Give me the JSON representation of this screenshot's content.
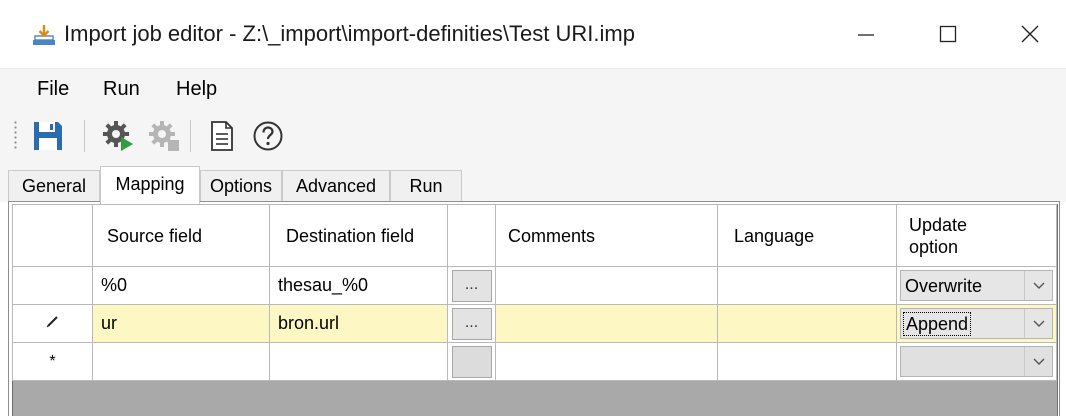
{
  "window": {
    "title": "Import job editor - Z:\\_import\\import-definities\\Test URI.imp",
    "minimize_label": "—",
    "maximize_label": "☐",
    "close_label": "✕"
  },
  "menu": {
    "items": [
      {
        "label": "File"
      },
      {
        "label": "Run"
      },
      {
        "label": "Help"
      }
    ]
  },
  "toolbar": {
    "buttons": [
      {
        "icon": "save-icon"
      },
      {
        "icon": "run-gear-icon"
      },
      {
        "icon": "run-gear-disabled-icon"
      },
      {
        "icon": "document-icon"
      },
      {
        "icon": "help-icon"
      }
    ]
  },
  "tabs": [
    {
      "label": "General",
      "selected": false
    },
    {
      "label": "Mapping",
      "selected": true
    },
    {
      "label": "Options",
      "selected": false
    },
    {
      "label": "Advanced",
      "selected": false
    },
    {
      "label": "Run",
      "selected": false
    }
  ],
  "grid": {
    "columns": {
      "source": "Source field",
      "destination": "Destination field",
      "comments": "Comments",
      "language": "Language",
      "update": "Update option"
    },
    "rows": [
      {
        "marker": "",
        "source": "%0",
        "destination": "thesau_%0",
        "button": "...",
        "comments": "",
        "language": "",
        "update": "Overwrite"
      },
      {
        "marker": "✎",
        "source": "ur",
        "destination": "bron.url",
        "button": "...",
        "comments": "",
        "language": "",
        "update": "Append"
      },
      {
        "marker": "*",
        "source": "",
        "destination": "",
        "button": "",
        "comments": "",
        "language": "",
        "update": ""
      }
    ]
  },
  "colors": {
    "current_row": "#fdf7c3",
    "grid_background": "#a9a9a9",
    "save_icon": "#2b6cb0",
    "run_arrow": "#2e9e3e"
  }
}
